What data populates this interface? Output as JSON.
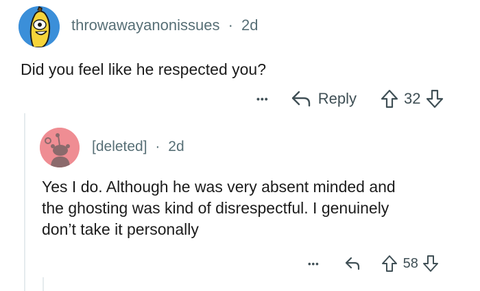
{
  "comment": {
    "username": "throwawayanonissues",
    "separator": "·",
    "time": "2d",
    "text": "Did you feel like he respected you?",
    "more_label": "•••",
    "reply_label": "Reply",
    "votes": "32"
  },
  "reply": {
    "username": "[deleted]",
    "separator": "·",
    "time": "2d",
    "text_lines": [
      "Yes I do. Although he was very absent minded and",
      "the ghosting was kind of disrespectful. I genuinely",
      "don’t take it personally"
    ],
    "more_label": "•••",
    "votes": "58"
  },
  "colors": {
    "main_avatar_bg": "#3b8fd9",
    "deleted_avatar_bg": "#ef8d93",
    "meta_text": "#576f76"
  }
}
